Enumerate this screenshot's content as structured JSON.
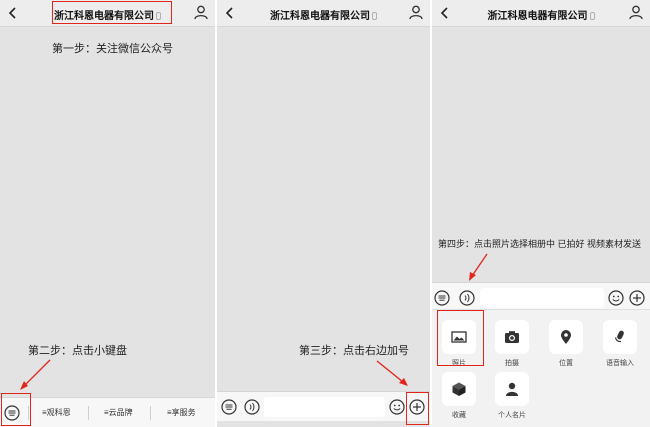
{
  "header": {
    "title": "浙江科恩电器有限公司"
  },
  "steps": {
    "step1": "第一步：关注微信公众号",
    "step2": "第二步：点击小键盘",
    "step3": "第三步：点击右边加号",
    "step4": "第四步：点击照片选择相册中 已拍好 视频素材发送"
  },
  "menu": {
    "items": [
      "观科恩",
      "云品牌",
      "享服务"
    ]
  },
  "plus_panel": {
    "items": [
      {
        "label": "照片",
        "icon": "photo-icon"
      },
      {
        "label": "拍摄",
        "icon": "camera-icon"
      },
      {
        "label": "位置",
        "icon": "location-icon"
      },
      {
        "label": "语音输入",
        "icon": "microphone-icon"
      },
      {
        "label": "收藏",
        "icon": "favorites-cube-icon"
      },
      {
        "label": "个人名片",
        "icon": "contact-card-icon"
      }
    ]
  },
  "colors": {
    "highlight": "#e0251b",
    "background": "#e3e3e3",
    "bar": "#f7f7f7"
  }
}
